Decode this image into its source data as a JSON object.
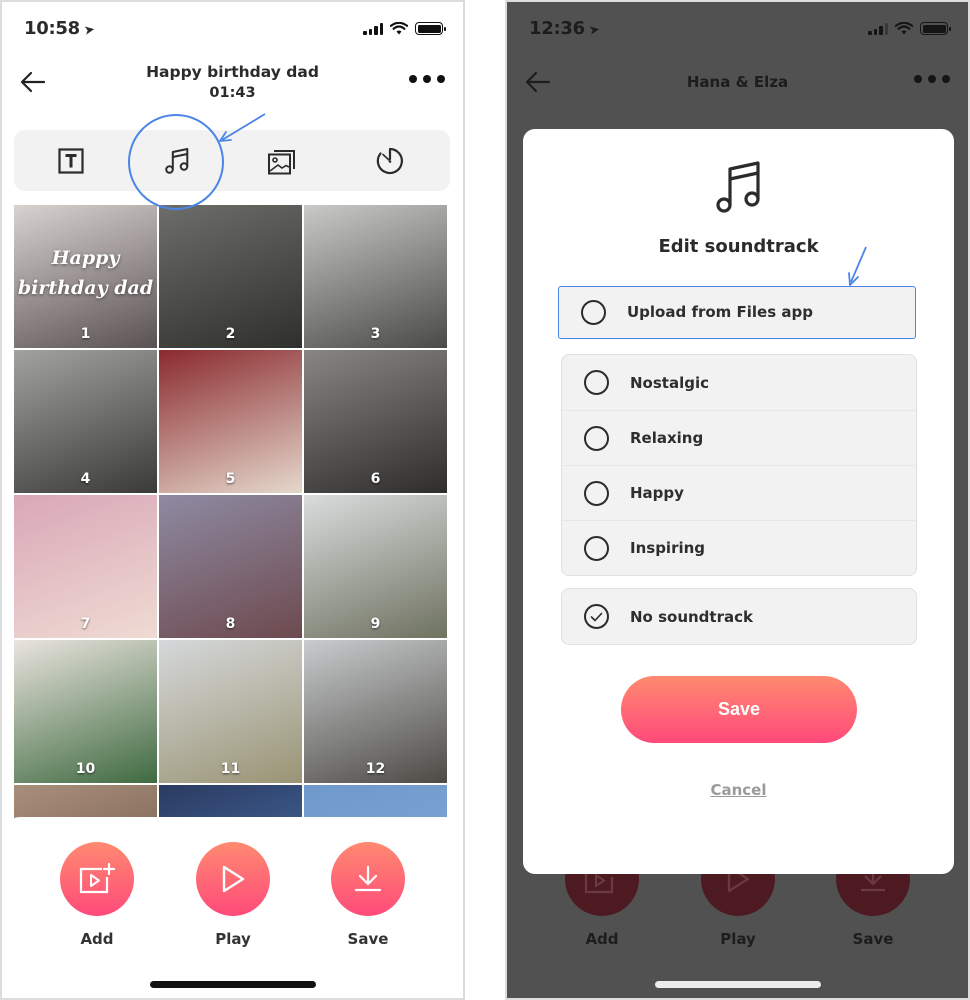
{
  "left_screen": {
    "status_bar": {
      "time": "10:58"
    },
    "header": {
      "title": "Happy birthday dad",
      "duration": "01:43"
    },
    "toolbar": {
      "tools": [
        {
          "name": "text",
          "icon": "text-box-icon"
        },
        {
          "name": "music",
          "icon": "music-note-icon",
          "highlighted": true
        },
        {
          "name": "photos",
          "icon": "photo-stack-icon"
        },
        {
          "name": "timer",
          "icon": "timer-icon"
        }
      ]
    },
    "photos": [
      {
        "number": "1",
        "overlay_text_line1": "Happy",
        "overlay_text_line2": "birthday dad",
        "colors": [
          "#d8d2d0",
          "#5a5252"
        ]
      },
      {
        "number": "2",
        "colors": [
          "#6d6d69",
          "#2f2f2c"
        ]
      },
      {
        "number": "3",
        "colors": [
          "#c9c9c7",
          "#4a4a48"
        ]
      },
      {
        "number": "4",
        "colors": [
          "#a2a2a0",
          "#3a3a38"
        ]
      },
      {
        "number": "5",
        "colors": [
          "#8a2a2e",
          "#e5d8cc"
        ]
      },
      {
        "number": "6",
        "colors": [
          "#888684",
          "#2e2d2b"
        ]
      },
      {
        "number": "7",
        "colors": [
          "#d9a7b7",
          "#efdbd3"
        ]
      },
      {
        "number": "8",
        "colors": [
          "#8e8aa2",
          "#6d4a4e"
        ]
      },
      {
        "number": "9",
        "colors": [
          "#dadcdd",
          "#6e7260"
        ]
      },
      {
        "number": "10",
        "colors": [
          "#e9e4de",
          "#3f6a40"
        ]
      },
      {
        "number": "11",
        "colors": [
          "#d5d8da",
          "#9a9474"
        ]
      },
      {
        "number": "12",
        "colors": [
          "#c8cccd",
          "#4d4a45"
        ]
      },
      {
        "number": "",
        "colors": [
          "#a88f7b",
          "#6a4e40"
        ]
      },
      {
        "number": "",
        "colors": [
          "#2a3b60",
          "#4f79b8"
        ]
      },
      {
        "number": "",
        "colors": [
          "#6f98cc",
          "#86abd5"
        ]
      }
    ],
    "actions": [
      {
        "label": "Add",
        "icon": "add-media-icon"
      },
      {
        "label": "Play",
        "icon": "play-icon"
      },
      {
        "label": "Save",
        "icon": "download-icon"
      }
    ]
  },
  "right_screen": {
    "status_bar": {
      "time": "12:36"
    },
    "header": {
      "title": "Hana & Elza"
    },
    "modal": {
      "title": "Edit soundtrack",
      "upload_option": {
        "label": "Upload from Files app",
        "selected": false
      },
      "mood_options": [
        {
          "label": "Nostalgic",
          "selected": false
        },
        {
          "label": "Relaxing",
          "selected": false
        },
        {
          "label": "Happy",
          "selected": false
        },
        {
          "label": "Inspiring",
          "selected": false
        }
      ],
      "none_option": {
        "label": "No soundtrack",
        "selected": true
      },
      "save_label": "Save",
      "cancel_label": "Cancel"
    },
    "actions": [
      {
        "label": "Add"
      },
      {
        "label": "Play"
      },
      {
        "label": "Save"
      }
    ]
  },
  "colors": {
    "accent_gradient_top": "#ff8a70",
    "accent_gradient_bottom": "#ff4a7a",
    "annotation_blue": "#4a86e8",
    "overlay_dim": "#515151"
  }
}
